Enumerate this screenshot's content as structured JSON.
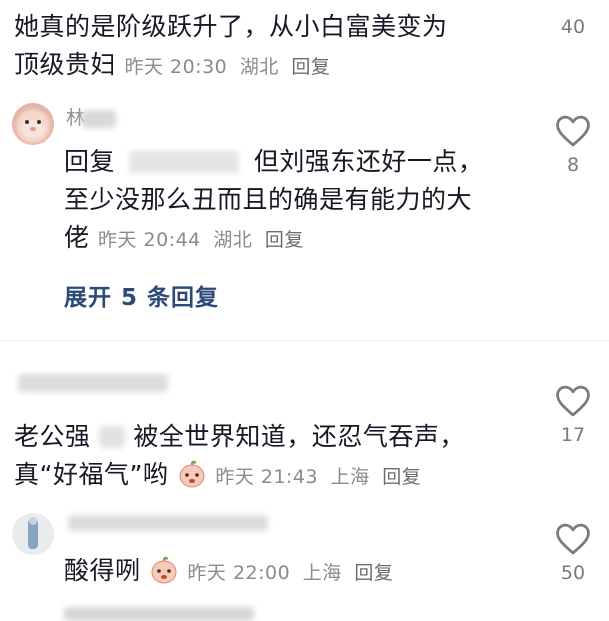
{
  "comments": [
    {
      "text_line1": "她真的是阶级跃升了，从小白富美变为",
      "text_line2": "顶级贵妇",
      "time": "昨天 20:30",
      "location": "湖北",
      "reply_label": "回复",
      "likes": "40"
    },
    {
      "author_visible": "林",
      "reply_prefix": "回复",
      "text_line1": "但刘强东还好一点，",
      "text_line2": "至少没那么丑而且的确是有能力的大",
      "text_line3": "佬",
      "time": "昨天 20:44",
      "location": "湖北",
      "reply_label": "回复",
      "likes": "8",
      "expand_label": "展开 5 条回复"
    },
    {
      "text_line1a": "老公强",
      "text_line1b": "被全世界知道，还忍气吞声，",
      "text_line2": "真“好福气”哟",
      "time": "昨天 21:43",
      "location": "上海",
      "reply_label": "回复",
      "likes": "17"
    },
    {
      "text": "酸得咧",
      "time": "昨天 22:00",
      "location": "上海",
      "reply_label": "回复",
      "likes": "50"
    }
  ],
  "icons": {
    "like": "heart-outline-icon",
    "emoji": "peach-crying-emoji"
  },
  "colors": {
    "text": "#161823",
    "meta": "#8a8b91",
    "expand": "#2b4a77"
  }
}
